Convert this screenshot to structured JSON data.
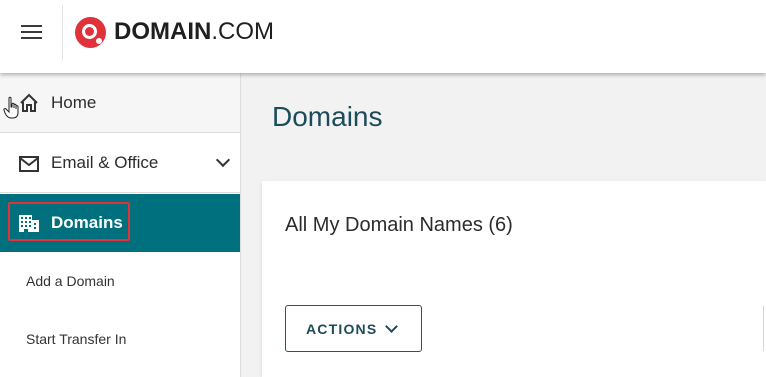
{
  "header": {
    "logo_bold": "DOMAIN",
    "logo_light": ".COM",
    "menu_icon": "hamburger-menu-icon"
  },
  "sidebar": {
    "items": [
      {
        "label": "Home",
        "icon": "home-icon"
      },
      {
        "label": "Email & Office",
        "icon": "envelope-icon",
        "expandable": true
      },
      {
        "label": "Domains",
        "icon": "building-icon",
        "active": true
      }
    ],
    "subitems": [
      "Add a Domain",
      "Start Transfer In"
    ]
  },
  "main": {
    "title": "Domains",
    "card_title": "All My Domain Names (6)",
    "actions_label": "ACTIONS"
  },
  "colors": {
    "brand_red": "#e0323b",
    "active_nav": "#00707f",
    "title_teal": "#1c4b5a",
    "highlight_box": "#e0323b"
  }
}
